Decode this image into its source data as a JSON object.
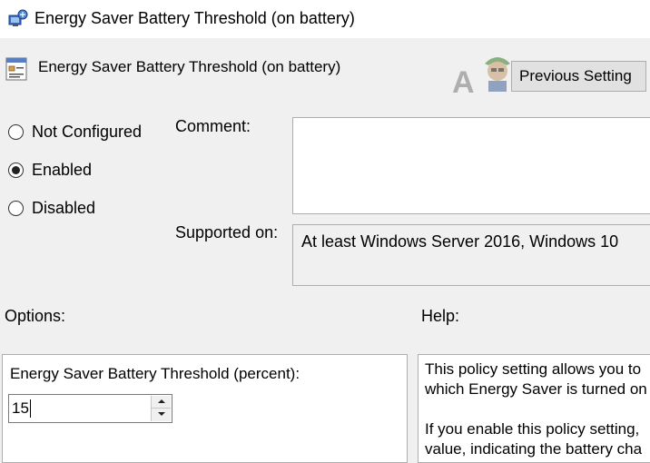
{
  "window": {
    "title": "Energy Saver Battery Threshold (on battery)"
  },
  "header": {
    "policy_title": "Energy Saver Battery Threshold (on battery)",
    "previous_setting_label": "Previous Setting",
    "watermark": "APPUALS"
  },
  "state": {
    "options": [
      {
        "label": "Not Configured",
        "checked": false
      },
      {
        "label": "Enabled",
        "checked": true
      },
      {
        "label": "Disabled",
        "checked": false
      }
    ]
  },
  "comment": {
    "label": "Comment:",
    "value": ""
  },
  "supported": {
    "label": "Supported on:",
    "value": "At least Windows Server 2016, Windows 10"
  },
  "options_section": {
    "label": "Options:",
    "threshold_label": "Energy Saver Battery Threshold (percent):",
    "threshold_value": "15"
  },
  "help_section": {
    "label": "Help:",
    "lines": [
      "This policy setting allows you to",
      "which Energy Saver is turned on",
      "If you enable this policy setting,",
      "value, indicating the battery cha"
    ]
  },
  "icons": {
    "title": "group-policy-icon",
    "policy": "policy-setting-icon",
    "spin_up": "chevron-up-icon",
    "spin_down": "chevron-down-icon"
  }
}
